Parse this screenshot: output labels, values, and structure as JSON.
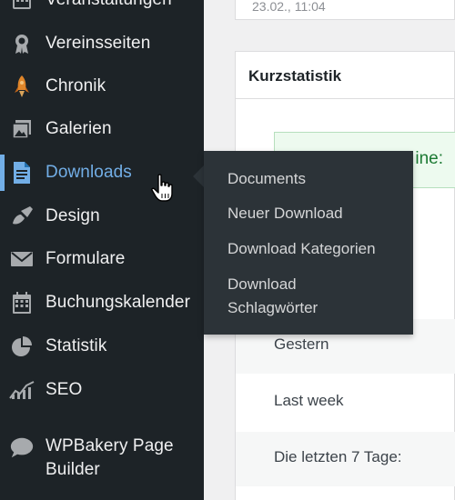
{
  "sidebar": {
    "items": [
      {
        "label": "Veranstaltungen",
        "icon": "calendar-icon"
      },
      {
        "label": "Vereinsseiten",
        "icon": "award-icon"
      },
      {
        "label": "Chronik",
        "icon": "rocket-icon"
      },
      {
        "label": "Galerien",
        "icon": "gallery-icon"
      },
      {
        "label": "Downloads",
        "icon": "document-icon",
        "current": true
      },
      {
        "label": "Design",
        "icon": "paintbrush-icon"
      },
      {
        "label": "Formulare",
        "icon": "envelope-icon"
      },
      {
        "label": "Buchungskalender",
        "icon": "calendar-grid-icon"
      },
      {
        "label": "Statistik",
        "icon": "pie-chart-icon"
      },
      {
        "label": "SEO",
        "icon": "seo-chart-icon"
      },
      {
        "label": "WPBakery Page Builder",
        "icon": "speech-bubble-icon"
      }
    ]
  },
  "flyout": {
    "items": [
      {
        "label": "Documents"
      },
      {
        "label": "Neuer Download"
      },
      {
        "label": "Download Kategorien"
      },
      {
        "label": "Download\nSchlagwörter"
      }
    ]
  },
  "main": {
    "top_card_text": "23.02., 11:04",
    "panel": {
      "title": "Kurzstatistik",
      "online_text": "ine:",
      "rows": [
        {
          "label": "Gestern"
        },
        {
          "label": "Last week"
        },
        {
          "label": "Die letzten 7 Tage:"
        }
      ]
    }
  },
  "colors": {
    "sidebar_bg": "#1d2327",
    "flyout_bg": "#2c3338",
    "accent": "#72aee6",
    "online_bg": "#edfaef",
    "online_text": "#1d7a34"
  }
}
